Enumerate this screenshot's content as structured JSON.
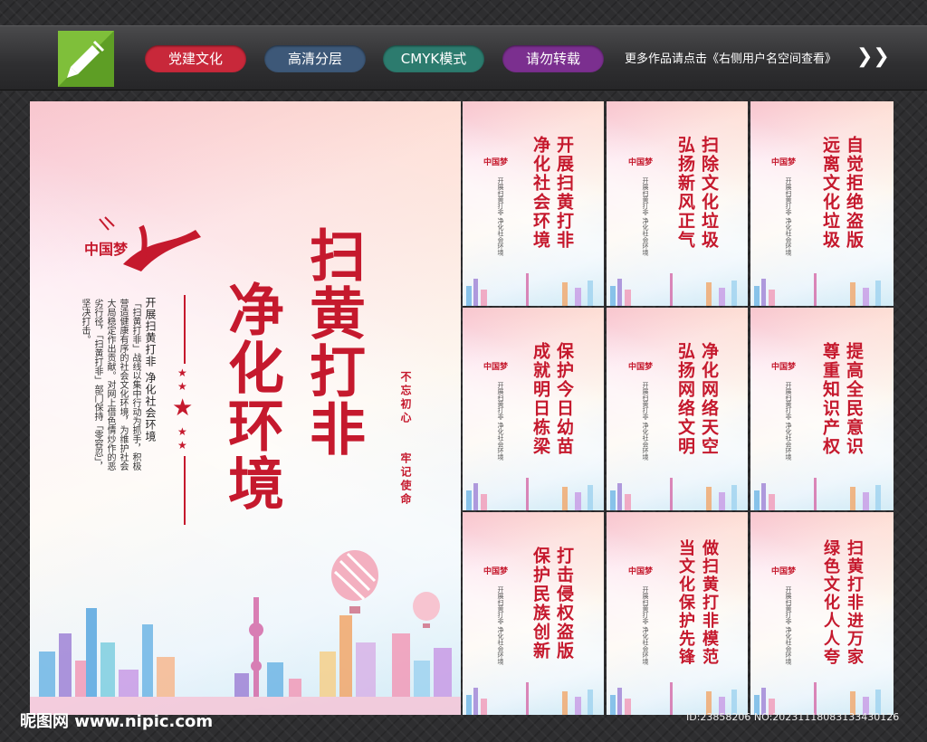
{
  "toolbar": {
    "tags": [
      {
        "label": "党建文化",
        "color": "#c8283a"
      },
      {
        "label": "高清分层",
        "color": "#3d5878"
      },
      {
        "label": "CMYK模式",
        "color": "#2c7b6e"
      },
      {
        "label": "请勿转载",
        "color": "#7b2f8f"
      }
    ],
    "note": "更多作品请点击《右侧用户名空间查看》",
    "arrow": "❯❯"
  },
  "main_poster": {
    "logo_text": "中国梦",
    "title_line1": "扫黄打非",
    "title_line2": "净化环境",
    "subtitle": "开展扫黄打非  净化社会环境",
    "body_text": "「扫黄打非」战线以集中行动为抓手，积极营造健康有序的社会文化环境，为维护社会大局稳定作出贡献。对网上借色情炒作的恶劣行径，「扫黄打非」部门保持「零容忍」，坚决打击。",
    "slogan_1": "不忘初心",
    "slogan_2": "牢记使命"
  },
  "small_posters": [
    {
      "line1": "开展扫黄打非",
      "line2": "净化社会环境"
    },
    {
      "line1": "扫除文化垃圾",
      "line2": "弘扬新风正气"
    },
    {
      "line1": "自觉拒绝盗版",
      "line2": "远离文化垃圾"
    },
    {
      "line1": "保护今日幼苗",
      "line2": "成就明日栋梁"
    },
    {
      "line1": "净化网络天空",
      "line2": "弘扬网络文明"
    },
    {
      "line1": "提高全民意识",
      "line2": "尊重知识产权"
    },
    {
      "line1": "打击侵权盗版",
      "line2": "保护民族创新"
    },
    {
      "line1": "做扫黄打非模范",
      "line2": "当文化保护先锋"
    },
    {
      "line1": "扫黄打非进万家",
      "line2": "绿色文化人人夸"
    }
  ],
  "small_common": {
    "logo_text": "中国梦",
    "sub_text": "开展扫黄打非  净化社会环境"
  },
  "footer": {
    "left": "昵图网  www.nipic.com",
    "right": "ID:23858206 NO:20231118083133430126"
  },
  "colors": {
    "accent": "#c5192d"
  }
}
